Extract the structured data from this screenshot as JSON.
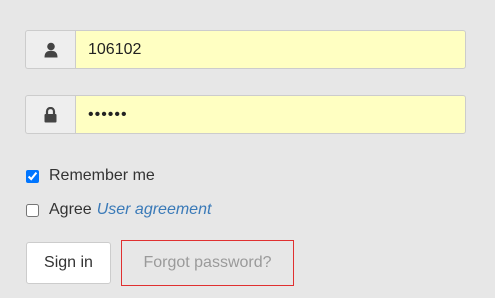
{
  "login_form": {
    "username": {
      "value": "106102",
      "icon": "user-icon"
    },
    "password": {
      "value": "••••••",
      "icon": "lock-icon"
    },
    "remember_me": {
      "label": "Remember me",
      "checked": true
    },
    "agree": {
      "label": "Agree",
      "link_text": "User agreement",
      "checked": false
    },
    "sign_in_label": "Sign in",
    "forgot_password_label": "Forgot password?"
  },
  "colors": {
    "background": "#e7e7e7",
    "input_fill": "#ffffc2",
    "link": "#3a7ab8",
    "highlight_border": "#e03030"
  }
}
